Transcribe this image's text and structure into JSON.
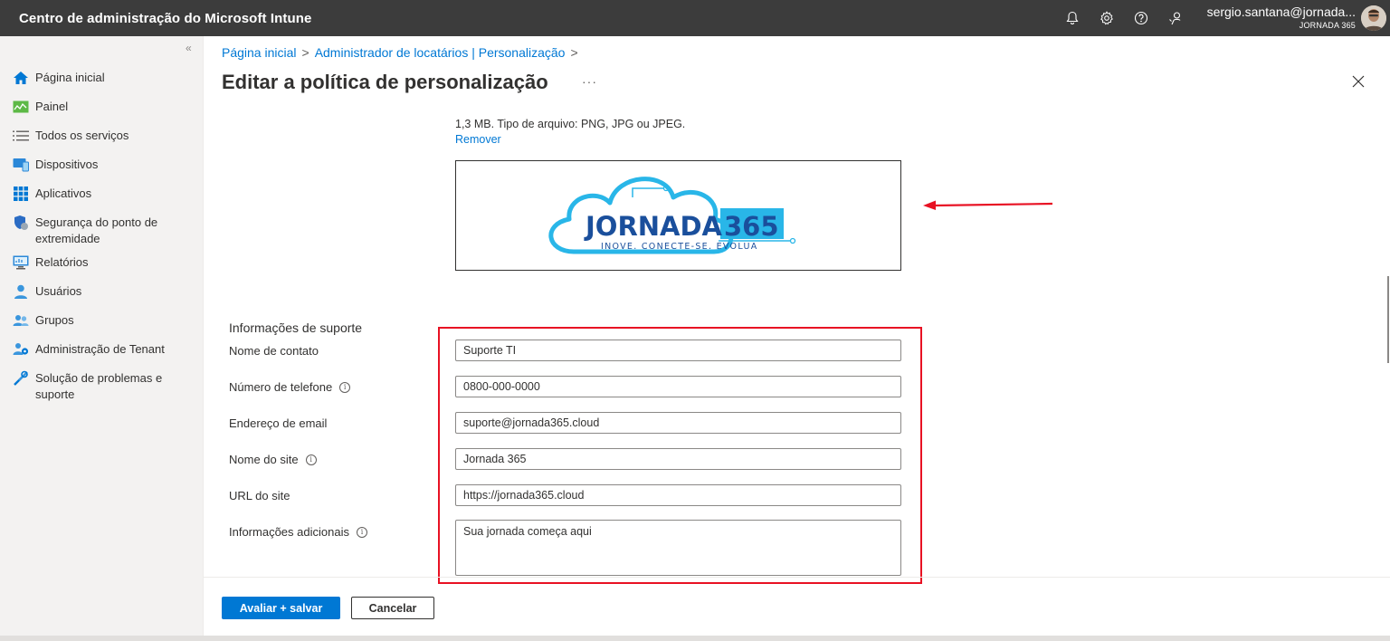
{
  "topbar": {
    "title": "Centro de administração do Microsoft Intune",
    "icons": [
      "bell-icon",
      "gear-icon",
      "help-icon",
      "feedback-icon"
    ],
    "account_email": "sergio.santana@jornada...",
    "account_tenant": "JORNADA 365"
  },
  "sidebar": {
    "collapse_glyph": "«",
    "items": [
      {
        "label": "Página inicial",
        "icon": "home-icon"
      },
      {
        "label": "Painel",
        "icon": "dashboard-icon"
      },
      {
        "label": "Todos os serviços",
        "icon": "list-icon"
      },
      {
        "label": "Dispositivos",
        "icon": "devices-icon"
      },
      {
        "label": "Aplicativos",
        "icon": "apps-icon"
      },
      {
        "label": "Segurança do ponto de extremidade",
        "icon": "shield-icon"
      },
      {
        "label": "Relatórios",
        "icon": "reports-icon"
      },
      {
        "label": "Usuários",
        "icon": "user-icon"
      },
      {
        "label": "Grupos",
        "icon": "groups-icon"
      },
      {
        "label": "Administração de Tenant",
        "icon": "tenant-admin-icon"
      },
      {
        "label": "Solução de problemas e suporte",
        "icon": "tools-icon"
      }
    ]
  },
  "breadcrumb": {
    "items": [
      "Página inicial",
      "Administrador de locatários | Personalização"
    ],
    "separator": ">"
  },
  "page": {
    "title": "Editar a política de personalização",
    "more": "···",
    "file_note": "1,3 MB. Tipo de arquivo: PNG, JPG ou JPEG.",
    "remove_link": "Remover",
    "logo": {
      "main_text": "JORNADA",
      "number_text": "365",
      "tagline": "INOVE. CONECTE-SE. EVOLUA"
    }
  },
  "support": {
    "section_title": "Informações de suporte",
    "fields": {
      "contact_name": {
        "label": "Nome de contato",
        "value": "Suporte TI"
      },
      "phone": {
        "label": "Número de telefone",
        "value": "0800-000-0000"
      },
      "email": {
        "label": "Endereço de email",
        "value": "suporte@jornada365.cloud"
      },
      "site_name": {
        "label": "Nome do site",
        "value": "Jornada 365"
      },
      "site_url": {
        "label": "URL do site",
        "value": "https://jornada365.cloud"
      },
      "additional": {
        "label": "Informações adicionais",
        "value": "Sua jornada começa aqui"
      }
    },
    "info_glyph": "i"
  },
  "footer": {
    "primary_button": "Avaliar + salvar",
    "secondary_button": "Cancelar"
  },
  "colors": {
    "accent": "#0078d4",
    "topbar": "#3c3c3c",
    "highlight": "#e81123",
    "logo_blue": "#1a4f9c",
    "logo_cyan": "#29b6e8"
  }
}
